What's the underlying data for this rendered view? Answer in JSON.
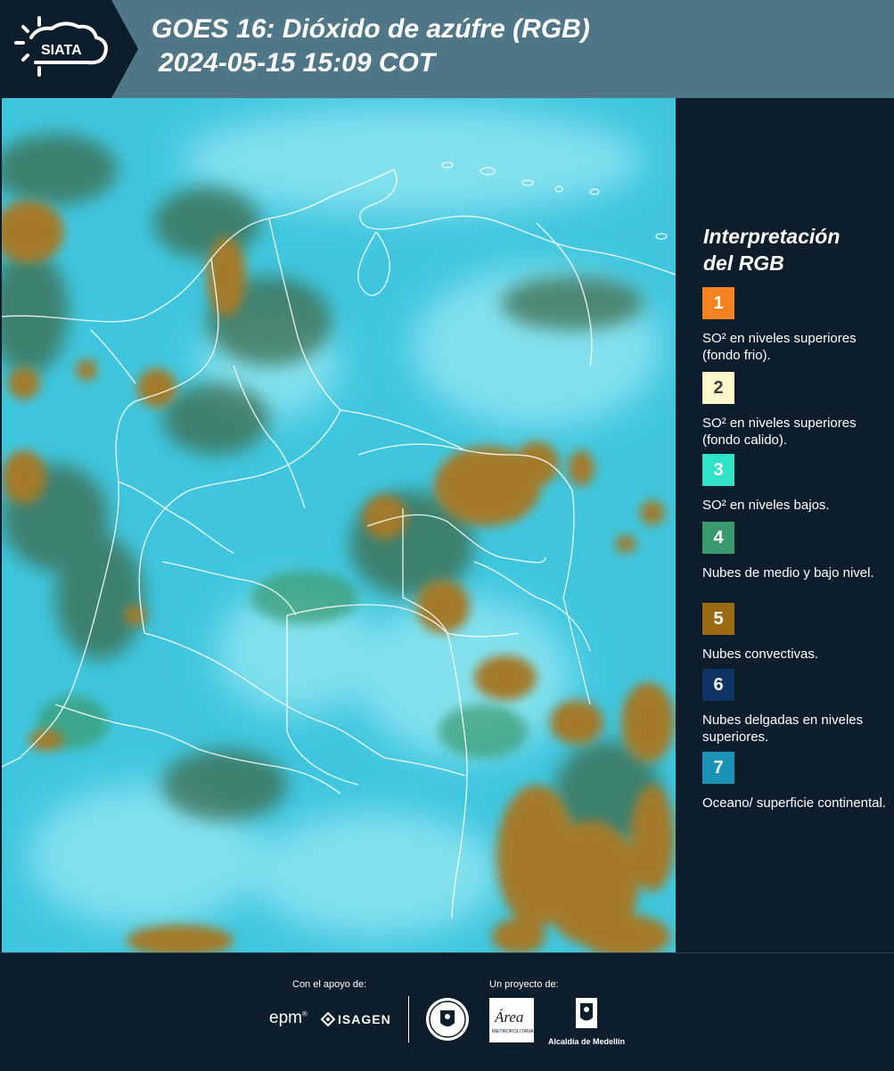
{
  "header": {
    "logo_text": "SIATA",
    "title_line1": "GOES 16: Dióxido de azúfre (RGB)",
    "title_line2": "2024-05-15 15:09 COT"
  },
  "legend": {
    "title_line1": "Interpretación",
    "title_line2": "del RGB",
    "items": [
      {
        "number": "1",
        "color": "#f5821f",
        "label": "SO² en niveles superiores (fondo frio)."
      },
      {
        "number": "2",
        "color": "#fdf6c8",
        "label": "SO² en niveles superiores (fondo calido)."
      },
      {
        "number": "3",
        "color": "#2de2c6",
        "label": "SO² en niveles bajos."
      },
      {
        "number": "4",
        "color": "#3a9a6d",
        "label": "Nubes de medio y bajo nivel."
      },
      {
        "number": "5",
        "color": "#9b6a12",
        "label": "Nubes convectivas."
      },
      {
        "number": "6",
        "color": "#0d3463",
        "label": "Nubes delgadas en niveles superiores."
      },
      {
        "number": "7",
        "color": "#1a93b7",
        "label": "Oceano/ superficie continental."
      }
    ]
  },
  "map": {
    "colors": {
      "cyan": "#3fc6de",
      "light_cyan": "#8fe6f2",
      "convective_brown": "#a27a2c",
      "dark_green": "#3e6a4c",
      "green": "#3a9a6d",
      "border": "#ffffff"
    }
  },
  "footer": {
    "support_label": "Con el apoyo de:",
    "project_label": "Un proyecto de:",
    "logo_epm": "epm",
    "logo_isagen": "ISAGEN",
    "logo_area_text": "Área",
    "logo_area_sub": "METROPOLITANA",
    "logo_alcaldia": "Alcaldía de Medellín"
  }
}
